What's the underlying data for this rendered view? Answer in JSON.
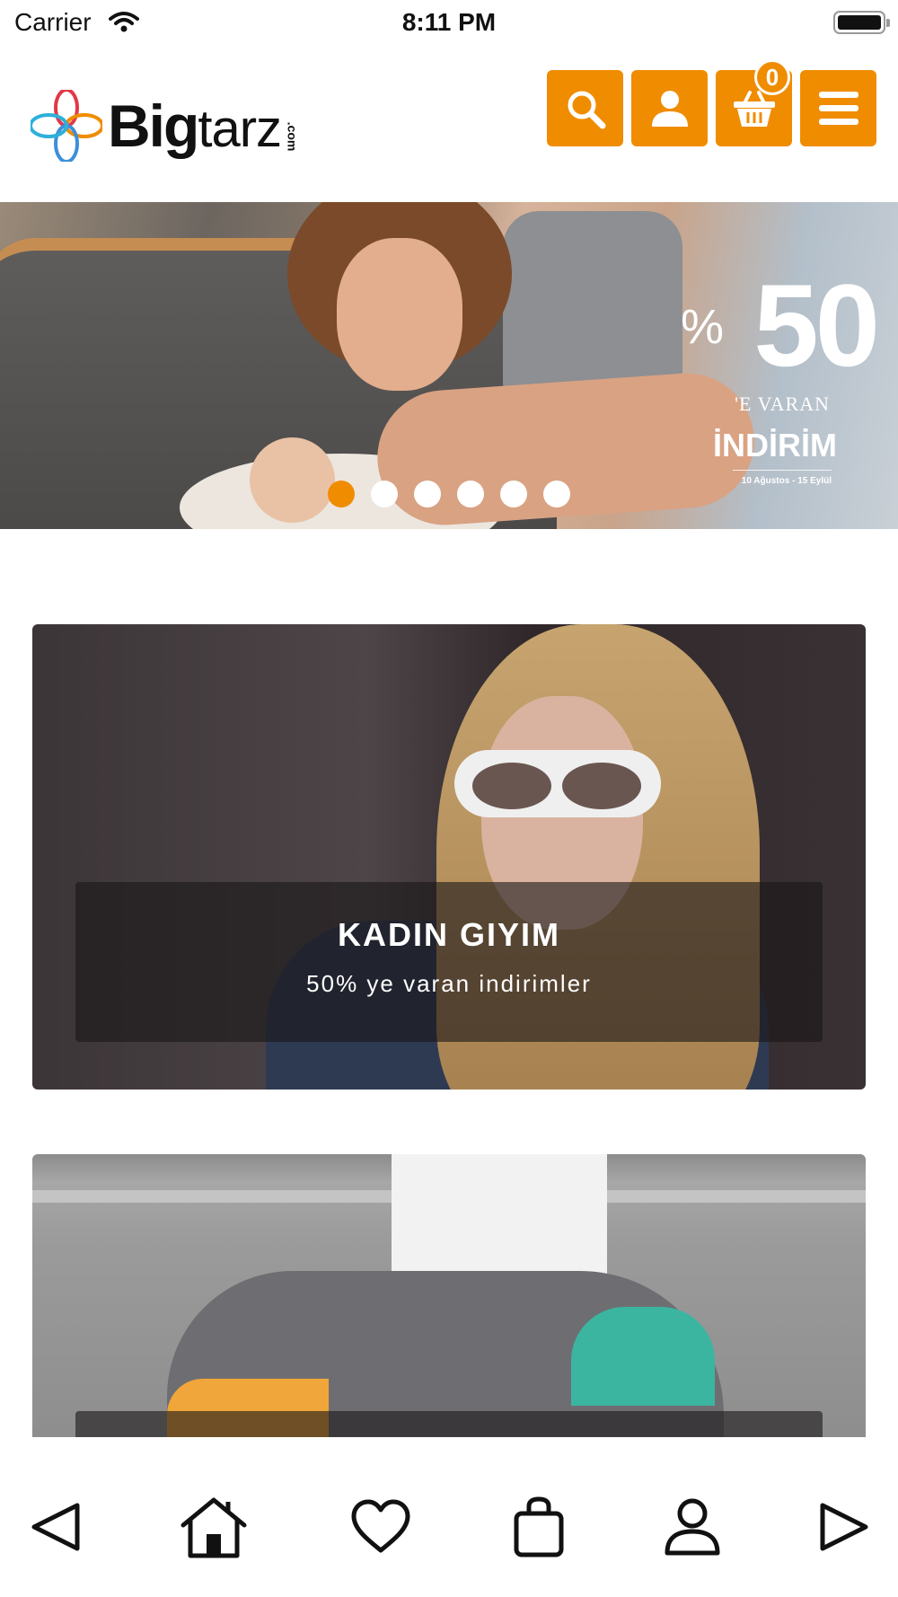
{
  "status_bar": {
    "carrier": "Carrier",
    "time": "8:11 PM"
  },
  "header": {
    "logo_big": "Big",
    "logo_tarz": "tarz",
    "logo_com": ".com",
    "cart_count": "0",
    "accent_color": "#f08c00",
    "icons": [
      "search-icon",
      "user-icon",
      "basket-icon",
      "menu-icon"
    ]
  },
  "hero": {
    "promo_percent": "%",
    "promo_number": "50",
    "promo_line1": "'E VARAN",
    "promo_line2": "İNDİRİM",
    "promo_dates": "10 Ağustos - 15 Eylül",
    "slide_count": 6,
    "active_slide": 1
  },
  "cards": [
    {
      "title": "KADIN GIYIM",
      "subtitle": "50% ye varan indirimler"
    }
  ],
  "bottom_nav": {
    "icons": [
      "back-arrow-icon",
      "home-icon",
      "heart-icon",
      "bag-icon",
      "profile-icon",
      "forward-arrow-icon"
    ]
  }
}
